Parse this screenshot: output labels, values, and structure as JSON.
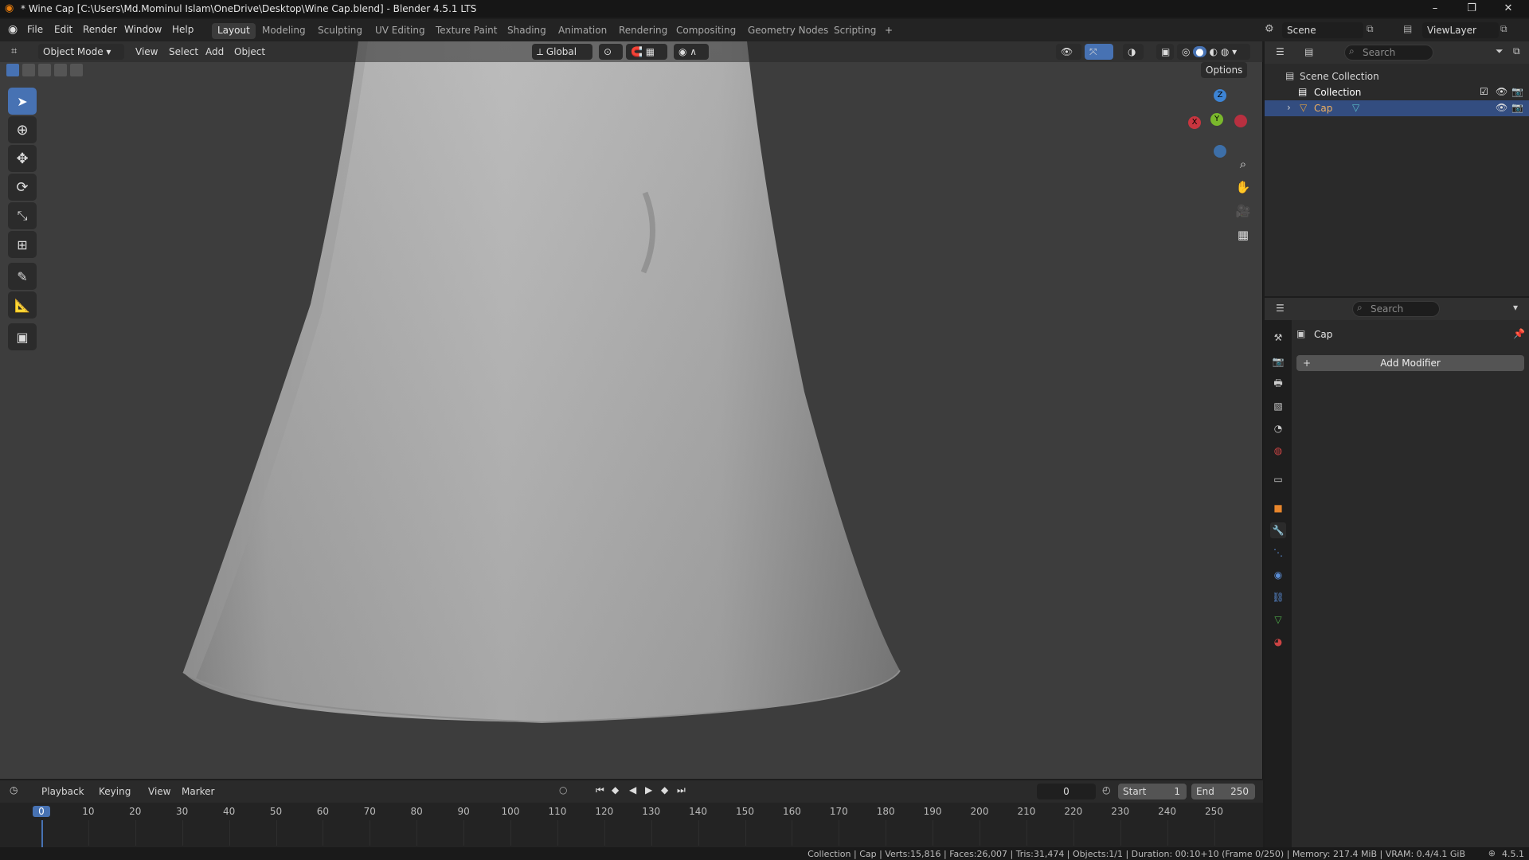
{
  "window": {
    "title": "* Wine Cap [C:\\Users\\Md.Mominul Islam\\OneDrive\\Desktop\\Wine Cap.blend] - Blender 4.5.1 LTS",
    "minimize": "–",
    "maximize": "❐",
    "close": "✕"
  },
  "menubar": {
    "items": [
      "File",
      "Edit",
      "Render",
      "Window",
      "Help"
    ],
    "workspaces": [
      "Layout",
      "Modeling",
      "Sculpting",
      "UV Editing",
      "Texture Paint",
      "Shading",
      "Animation",
      "Rendering",
      "Compositing",
      "Geometry Nodes",
      "Scripting"
    ],
    "active_workspace": "Layout",
    "add_tab": "+",
    "scene": "Scene",
    "view_layer": "ViewLayer"
  },
  "viewport": {
    "mode": "Object Mode",
    "menu": [
      "View",
      "Select",
      "Add",
      "Object"
    ],
    "orientation": "Global",
    "options": "Options",
    "gizmo": {
      "x": "X",
      "y": "Y",
      "z": "Z"
    }
  },
  "outliner": {
    "search_placeholder": "Search",
    "items": [
      {
        "label": "Scene Collection"
      },
      {
        "label": "Collection"
      },
      {
        "label": "Cap"
      }
    ]
  },
  "properties": {
    "search_placeholder": "Search",
    "object_name": "Cap",
    "add_modifier": "Add Modifier",
    "add_icon": "+"
  },
  "timeline": {
    "menu": [
      "Playback",
      "Keying",
      "View",
      "Marker"
    ],
    "current_frame": "0",
    "start_label": "Start",
    "start": "1",
    "end_label": "End",
    "end": "250",
    "ticks": [
      "0",
      "10",
      "20",
      "30",
      "40",
      "50",
      "60",
      "70",
      "80",
      "90",
      "100",
      "110",
      "120",
      "130",
      "140",
      "150",
      "160",
      "170",
      "180",
      "190",
      "200",
      "210",
      "220",
      "230",
      "240",
      "250"
    ]
  },
  "statusbar": {
    "text": "Collection | Cap | Verts:15,816 | Faces:26,007 | Tris:31,474 | Objects:1/1 | Duration: 00:10+10 (Frame 0/250) | Memory: 217.4 MiB | VRAM: 0.4/4.1 GiB",
    "version": "4.5.1"
  },
  "colors": {
    "accent": "#4772b3",
    "selected_row": "#334d80",
    "x_axis": "#c8353f",
    "y_axis": "#7ab82c",
    "z_axis": "#3d84d4"
  }
}
